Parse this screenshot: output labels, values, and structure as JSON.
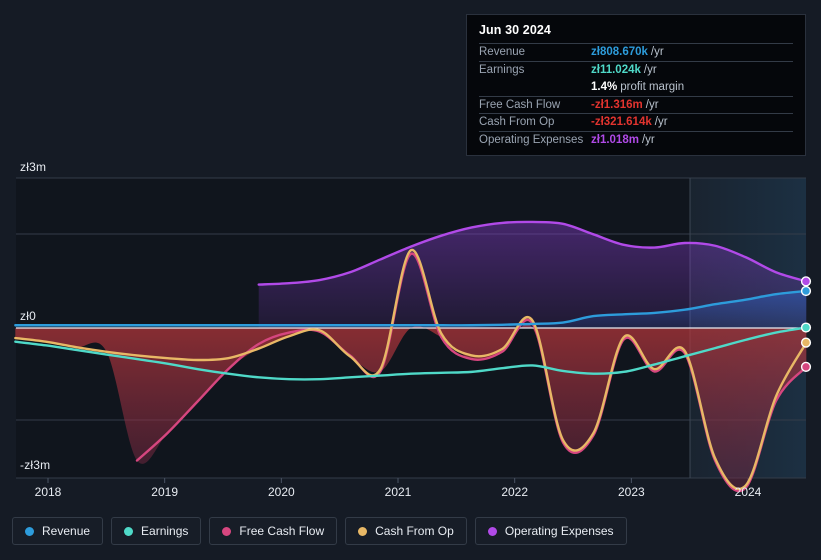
{
  "chart_data": {
    "type": "area",
    "title": "",
    "xlabel": "",
    "ylabel": "",
    "currency_symbol": "zł",
    "ylim": [
      -3000000,
      3000000
    ],
    "y_ticks": [
      "zł3m",
      "zł0",
      "-zł3m"
    ],
    "y_tick_values": [
      3000000,
      0,
      -3000000
    ],
    "x_ticks": [
      "2018",
      "2019",
      "2020",
      "2021",
      "2022",
      "2023",
      "2024"
    ],
    "grid": true,
    "legend_position": "bottom-left",
    "forecast_region_start": "2023.3",
    "series": [
      {
        "name": "Revenue",
        "color": "#2d9cdb",
        "values": [
          0.06,
          0.06,
          0.06,
          0.06,
          0.06,
          0.06,
          0.06,
          0.06,
          0.06,
          0.06,
          0.06,
          0.06,
          0.06,
          0.06,
          0.06,
          0.06,
          0.07,
          0.09,
          0.12,
          0.26,
          0.3,
          0.33,
          0.4,
          0.52,
          0.62,
          0.74,
          0.81
        ]
      },
      {
        "name": "Earnings",
        "color": "#4fd9c8",
        "values": [
          -0.3,
          -0.38,
          -0.48,
          -0.58,
          -0.68,
          -0.78,
          -0.9,
          -1.0,
          -1.08,
          -1.12,
          -1.12,
          -1.08,
          -1.04,
          -1.0,
          -0.98,
          -0.96,
          -0.88,
          -0.82,
          -0.94,
          -1.0,
          -0.96,
          -0.8,
          -0.62,
          -0.44,
          -0.26,
          -0.1,
          0.01
        ]
      },
      {
        "name": "Free Cash Flow",
        "color": "#d6467f",
        "values": [
          null,
          null,
          null,
          null,
          -2.9,
          -2.3,
          -1.6,
          -0.9,
          -0.35,
          -0.1,
          -0.08,
          -0.6,
          -0.95,
          1.62,
          -0.2,
          -0.68,
          -0.52,
          0.1,
          -2.5,
          -2.35,
          -0.25,
          -0.95,
          -0.55,
          -2.9,
          -3.5,
          -1.6,
          -0.85
        ]
      },
      {
        "name": "Cash From Op",
        "color": "#e8b866",
        "values": [
          -0.22,
          -0.3,
          -0.42,
          -0.52,
          -0.6,
          -0.66,
          -0.7,
          -0.66,
          -0.45,
          -0.18,
          -0.05,
          -0.62,
          -0.9,
          1.7,
          -0.12,
          -0.6,
          -0.46,
          0.16,
          -2.45,
          -2.3,
          -0.2,
          -0.9,
          -0.5,
          -2.85,
          -3.45,
          -1.5,
          -0.32
        ]
      },
      {
        "name": "Operating Expenses",
        "color": "#b14ae8",
        "values": [
          null,
          null,
          null,
          null,
          null,
          null,
          null,
          null,
          0.95,
          0.98,
          1.05,
          1.22,
          1.5,
          1.78,
          2.02,
          2.2,
          2.3,
          2.32,
          2.28,
          2.05,
          1.82,
          1.76,
          1.86,
          1.8,
          1.55,
          1.22,
          1.02
        ]
      }
    ]
  },
  "tooltip": {
    "date": "Jun 30 2024",
    "rows": [
      {
        "name": "Revenue",
        "value": "zł808.670k",
        "suffix": "/yr",
        "color": "#2d9cdb"
      },
      {
        "name": "Earnings",
        "value": "zł11.024k",
        "suffix": "/yr",
        "color": "#4fd9c8"
      },
      {
        "name": "",
        "value": "1.4%",
        "suffix": "profit margin",
        "color": "#ffffff"
      },
      {
        "name": "Free Cash Flow",
        "value": "-zł1.316m",
        "suffix": "/yr",
        "color": "#e3342f"
      },
      {
        "name": "Cash From Op",
        "value": "-zł321.614k",
        "suffix": "/yr",
        "color": "#e3342f"
      },
      {
        "name": "Operating Expenses",
        "value": "zł1.018m",
        "suffix": "/yr",
        "color": "#b14ae8"
      }
    ]
  },
  "y_axis": {
    "top": "zł3m",
    "middle": "zł0",
    "bottom": "-zł3m"
  },
  "x_axis": {
    "ticks": [
      "2018",
      "2019",
      "2020",
      "2021",
      "2022",
      "2023",
      "2024"
    ]
  },
  "legend": {
    "items": [
      {
        "label": "Revenue",
        "color": "#2d9cdb"
      },
      {
        "label": "Earnings",
        "color": "#4fd9c8"
      },
      {
        "label": "Free Cash Flow",
        "color": "#d6467f"
      },
      {
        "label": "Cash From Op",
        "color": "#e8b866"
      },
      {
        "label": "Operating Expenses",
        "color": "#b14ae8"
      }
    ]
  }
}
